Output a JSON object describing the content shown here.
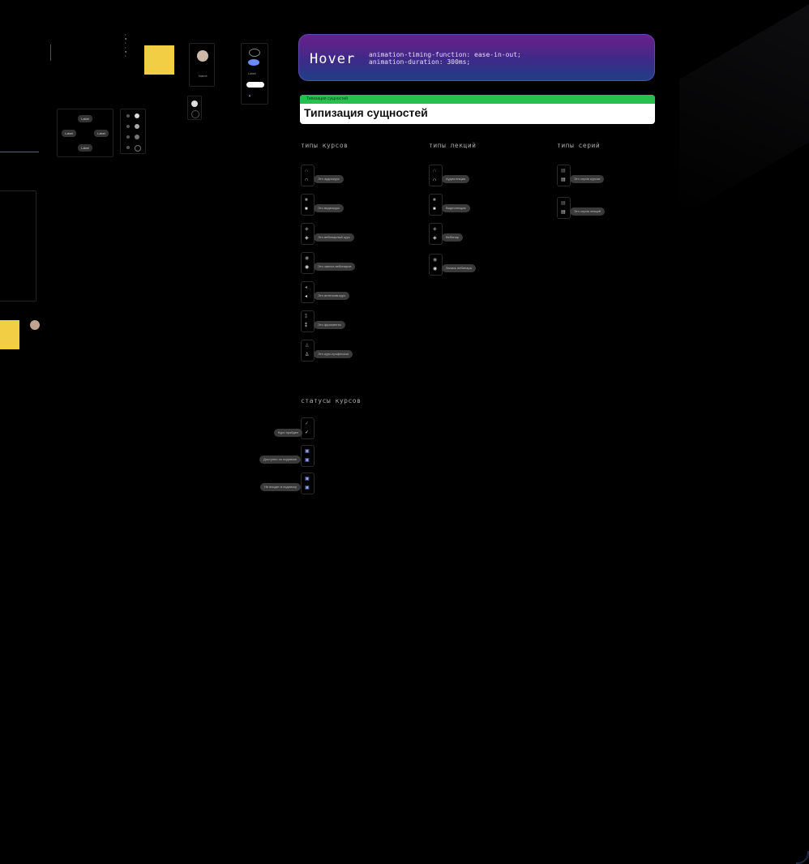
{
  "hover": {
    "title": "Hover",
    "code_line1": "animation-timing-function: ease-in-out;",
    "code_line2": "animation-duration: 300ms;"
  },
  "section": {
    "breadcrumb": "Типизация сущностей",
    "title": "Типизация сущностей"
  },
  "columns": {
    "courses": {
      "heading": "типы курсов",
      "items": [
        "Это аудиокурс",
        "Это видеокурс",
        "Это вебинарный курс",
        "Это запись вебинаров",
        "Это интенсив-курс",
        "Это фрагменты",
        "Это курс-профессия"
      ]
    },
    "lectures": {
      "heading": "типы лекций",
      "items": [
        "Аудиолекция",
        "Видеолекция",
        "Вебинар",
        "Запись вебинара"
      ]
    },
    "series": {
      "heading": "типы серий",
      "items": [
        "Это серия курсов",
        "Это серия лекций"
      ]
    }
  },
  "statuses": {
    "heading": "статусы курсов",
    "items": [
      "Курс пройден",
      "Доступно по подписке",
      "Не входит в подписку"
    ]
  },
  "left_widgets": {
    "buttons": [
      "Label",
      "Label",
      "Label",
      "Label"
    ],
    "avatar_name": "Name",
    "chip_label": "Label"
  },
  "colors": {
    "background": "#000000",
    "accent_green": "#27c04f",
    "hover_purple": "#6a1f8a",
    "hover_blue": "#1e3f85",
    "sticky_yellow": "#f2ce45"
  }
}
